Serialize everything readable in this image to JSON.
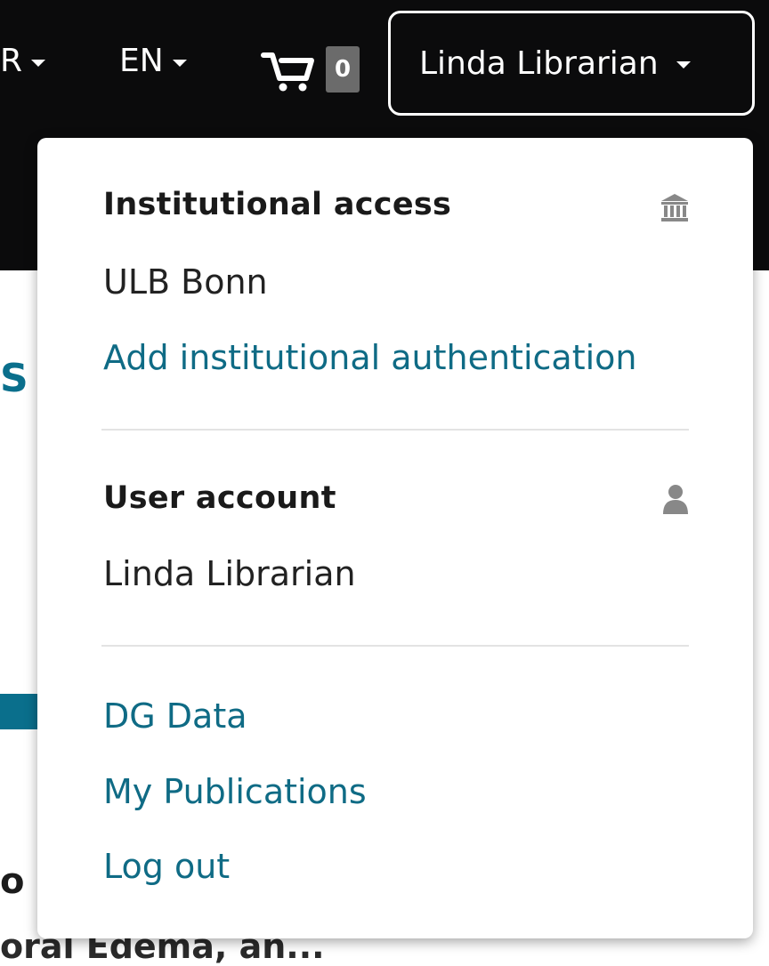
{
  "topbar": {
    "currency_label": "R",
    "language_label": "EN",
    "cart_count": "0",
    "user_button_label": "Linda Librarian"
  },
  "menu": {
    "institutional": {
      "header": "Institutional access",
      "icon": "institution-icon",
      "institution_name": "ULB Bonn",
      "add_auth_label": "Add institutional authentication"
    },
    "user": {
      "header": "User account",
      "icon": "user-icon",
      "user_name": "Linda Librarian"
    },
    "links": {
      "dg_data": "DG Data",
      "my_publications": "My Publications",
      "log_out": "Log out"
    }
  },
  "background": {
    "fragment_s": "S",
    "fragment_o": "o",
    "fragment_author": "oral Edema, an..."
  },
  "colors": {
    "topbar_bg": "#0b0b0c",
    "link": "#0f6b85",
    "arrow": "#0a6f8c",
    "cart_badge": "#6b6b6b"
  }
}
